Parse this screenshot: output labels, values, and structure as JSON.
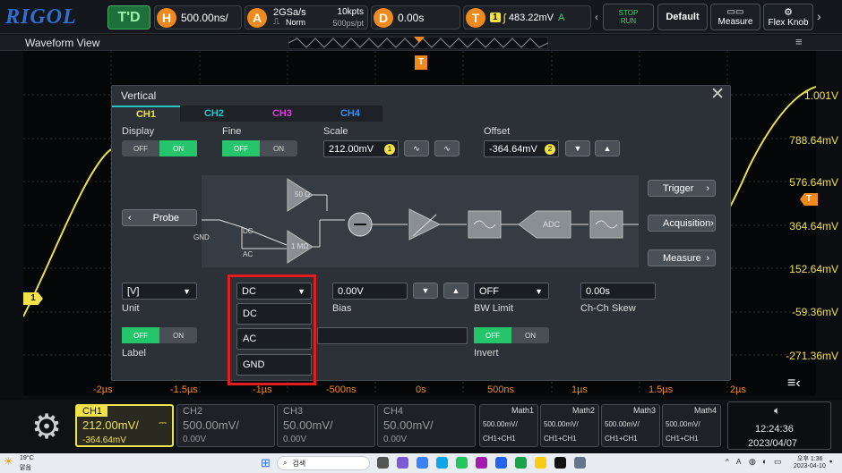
{
  "topbar": {
    "logo": "RIGOL",
    "mode": "T'D",
    "h_label": "H",
    "h_scale": "500.00ns/",
    "a_label": "A",
    "sample_rate": "2GSa/s",
    "mem_depth": "10kpts",
    "acq_mode": "Norm",
    "pts_rate": "500ps/pt",
    "d_label": "D",
    "delay": "0.00s",
    "t_label": "T",
    "trig_source": "1",
    "trig_level": "483.22mV",
    "trig_coupling": "A",
    "stop_run_top": "STOP",
    "stop_run_bottom": "RUN",
    "default": "Default",
    "measure": "Measure",
    "flex_knob": "Flex Knob"
  },
  "waveform": {
    "title": "Waveform View",
    "trigger_marker": "T",
    "ch1_marker": "1",
    "trig_level_marker": "T",
    "volt_labels": [
      "1.001V",
      "788.64mV",
      "576.64mV",
      "364.64mV",
      "152.64mV",
      "-59.36mV",
      "-271.36mV"
    ],
    "time_labels": [
      "-2µs",
      "-1.5µs",
      "-1µs",
      "-500ns",
      "0s",
      "500ns",
      "1µs",
      "1.5µs",
      "2µs"
    ]
  },
  "dialog": {
    "title": "Vertical",
    "tabs": [
      "CH1",
      "CH2",
      "CH3",
      "CH4"
    ],
    "tab_colors": [
      "#f2e24a",
      "#23c6c6",
      "#e23be0",
      "#2f8ff0"
    ],
    "display_label": "Display",
    "fine_label": "Fine",
    "off": "OFF",
    "on": "ON",
    "scale_label": "Scale",
    "scale_value": "212.00mV",
    "scale_badge": "1",
    "offset_label": "Offset",
    "offset_value": "-364.64mV",
    "offset_badge": "2",
    "probe": "Probe",
    "gnd": "GND",
    "dc": "DC",
    "ac": "AC",
    "r50": "50 Ω",
    "r1m": "1 MΩ",
    "adc": "ADC",
    "trigger_btn": "Trigger",
    "acquisition_btn": "Acquisition",
    "measure_btn": "Measure",
    "unit_value": "[V]",
    "unit_label": "Unit",
    "coupling_value": "DC",
    "coupling_options": [
      "DC",
      "AC",
      "GND"
    ],
    "bias_value": "0.00V",
    "bias_label": "Bias",
    "bw_value": "OFF",
    "bw_label": "BW Limit",
    "skew_value": "0.00s",
    "skew_label": "Ch-Ch Skew",
    "label_label": "Label",
    "invert_label": "Invert"
  },
  "bottom": {
    "ch1": {
      "name": "CH1",
      "scale": "212.00mV/",
      "offset": "-364.64mV"
    },
    "ch2": {
      "name": "CH2",
      "scale": "500.00mV/",
      "offset": "0.00V"
    },
    "ch3": {
      "name": "CH3",
      "scale": "50.00mV/",
      "offset": "0.00V"
    },
    "ch4": {
      "name": "CH4",
      "scale": "50.00mV/",
      "offset": "0.00V"
    },
    "maths": [
      {
        "name": "Math1",
        "scale": "500.00mV/",
        "src": "CH1+CH1"
      },
      {
        "name": "Math2",
        "scale": "500.00mV/",
        "src": "CH1+CH1"
      },
      {
        "name": "Math3",
        "scale": "500.00mV/",
        "src": "CH1+CH1"
      },
      {
        "name": "Math4",
        "scale": "500.00mV/",
        "src": "CH1+CH1"
      }
    ],
    "time": "12:24:36",
    "date": "2023/04/07"
  },
  "taskbar": {
    "weather_temp": "19°C",
    "weather_text": "맑음",
    "search": "검색",
    "lang": "A",
    "clock_ampm": "오후 1:36",
    "clock_date": "2023-04-10"
  }
}
